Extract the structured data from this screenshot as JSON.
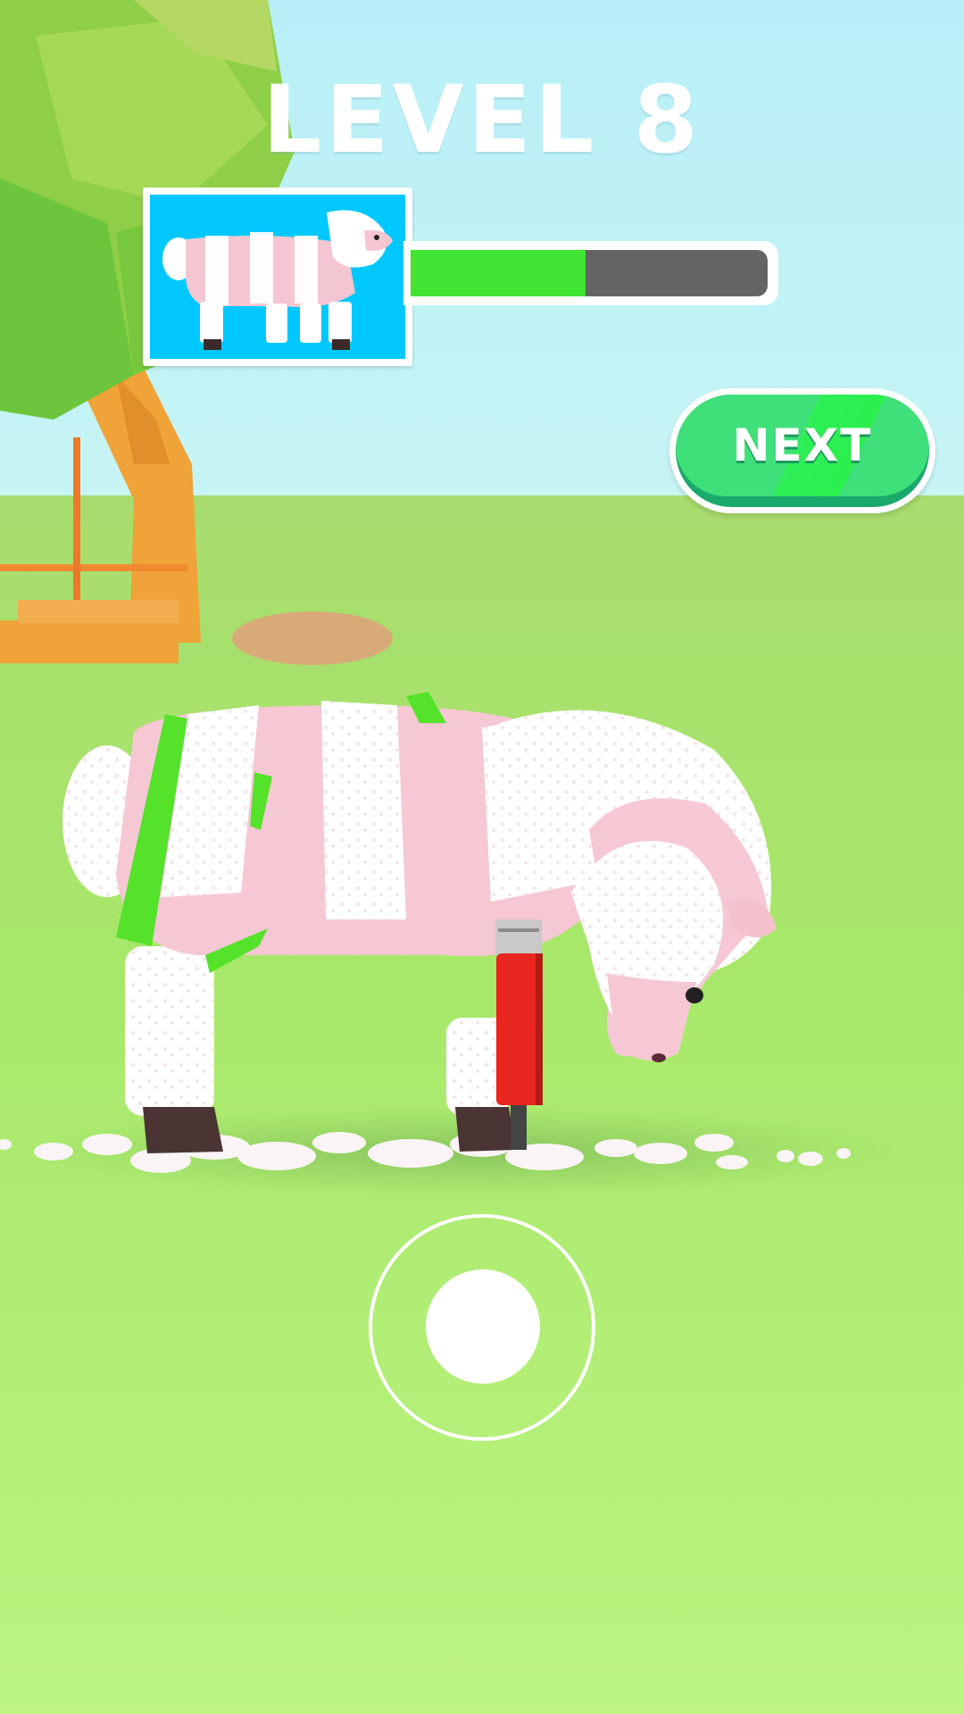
{
  "hud": {
    "level_label": "LEVEL 8",
    "progress": 0.49,
    "progress_fill_color": "#3fe532",
    "progress_track_color": "#646464"
  },
  "goal_preview": {
    "background_color": "#00c8ff",
    "icon": "sheep-goal-pattern-icon"
  },
  "next_button": {
    "label": "NEXT",
    "color": "#3fe07a"
  },
  "joystick": {
    "icon": "joystick-knob-icon"
  },
  "scene": {
    "sky_color": "#bdf0f7",
    "grass_color": "#b8f07e",
    "sheep_color": "#f6c9d4",
    "paint_color": "#55e22b",
    "clipper_color": "#e8261f"
  }
}
